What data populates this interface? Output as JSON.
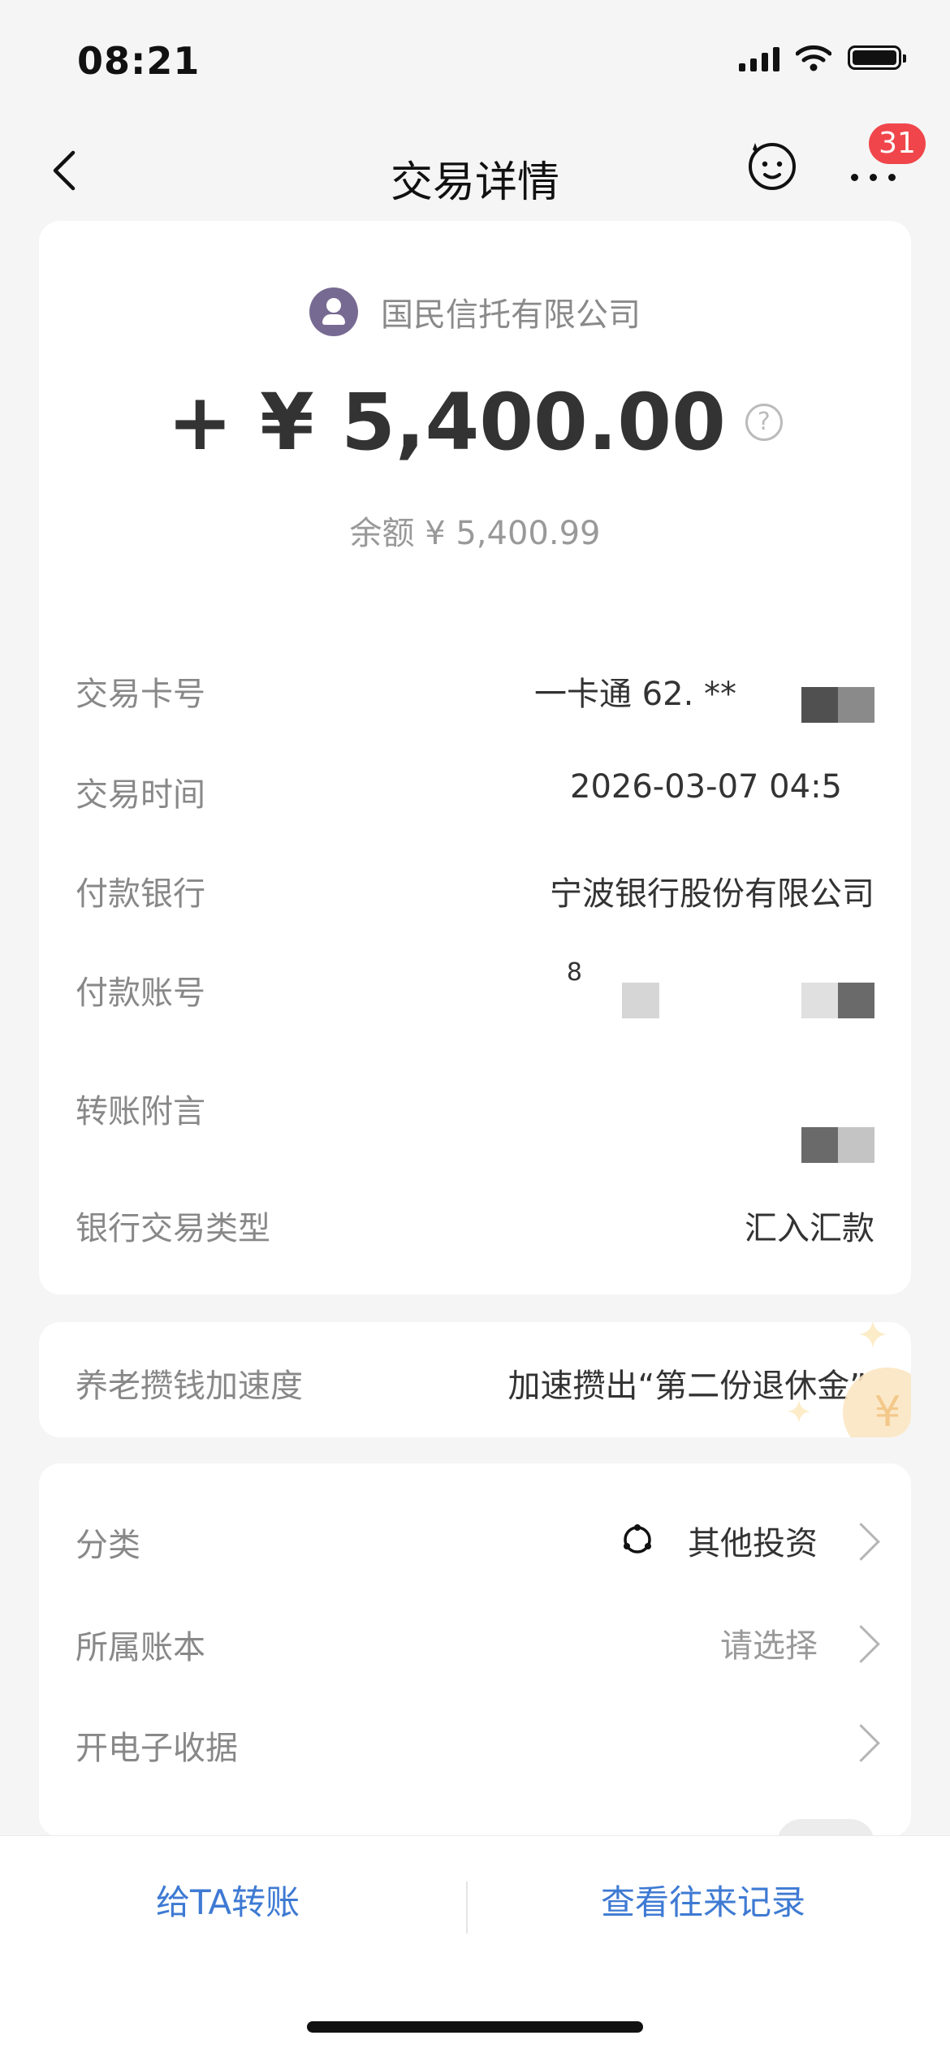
{
  "status_bar": {
    "time": "08:21"
  },
  "nav": {
    "title": "交易详情",
    "badge_count": "31"
  },
  "summary": {
    "payer_name": "国民信托有限公司",
    "amount": "+ ¥ 5,400.00",
    "help_glyph": "?",
    "balance": "余额 ¥ 5,400.99"
  },
  "details": [
    {
      "label": "交易卡号",
      "value": "一卡通 62.   **"
    },
    {
      "label": "交易时间",
      "value": "2026-03-07 04:5"
    },
    {
      "label": "付款银行",
      "value": "宁波银行股份有限公司"
    },
    {
      "label": "付款账号",
      "value": "8"
    },
    {
      "label": "转账附言",
      "value": ""
    },
    {
      "label": "银行交易类型",
      "value": "汇入汇款"
    }
  ],
  "pension": {
    "label": "养老攒钱加速度",
    "value": "加速攒出“第二份退休金”",
    "coin_glyph": "¥"
  },
  "settings": {
    "category_label": "分类",
    "category_value": "其他投资",
    "ledger_label": "所属账本",
    "ledger_value": "请选择",
    "receipt_label": "开电子收据"
  },
  "bottom": {
    "transfer": "给TA转账",
    "history": "查看往来记录"
  },
  "colors": {
    "accent_blue": "#3e7ad3",
    "badge_red": "#f0464b",
    "avatar_purple": "#776a92"
  }
}
